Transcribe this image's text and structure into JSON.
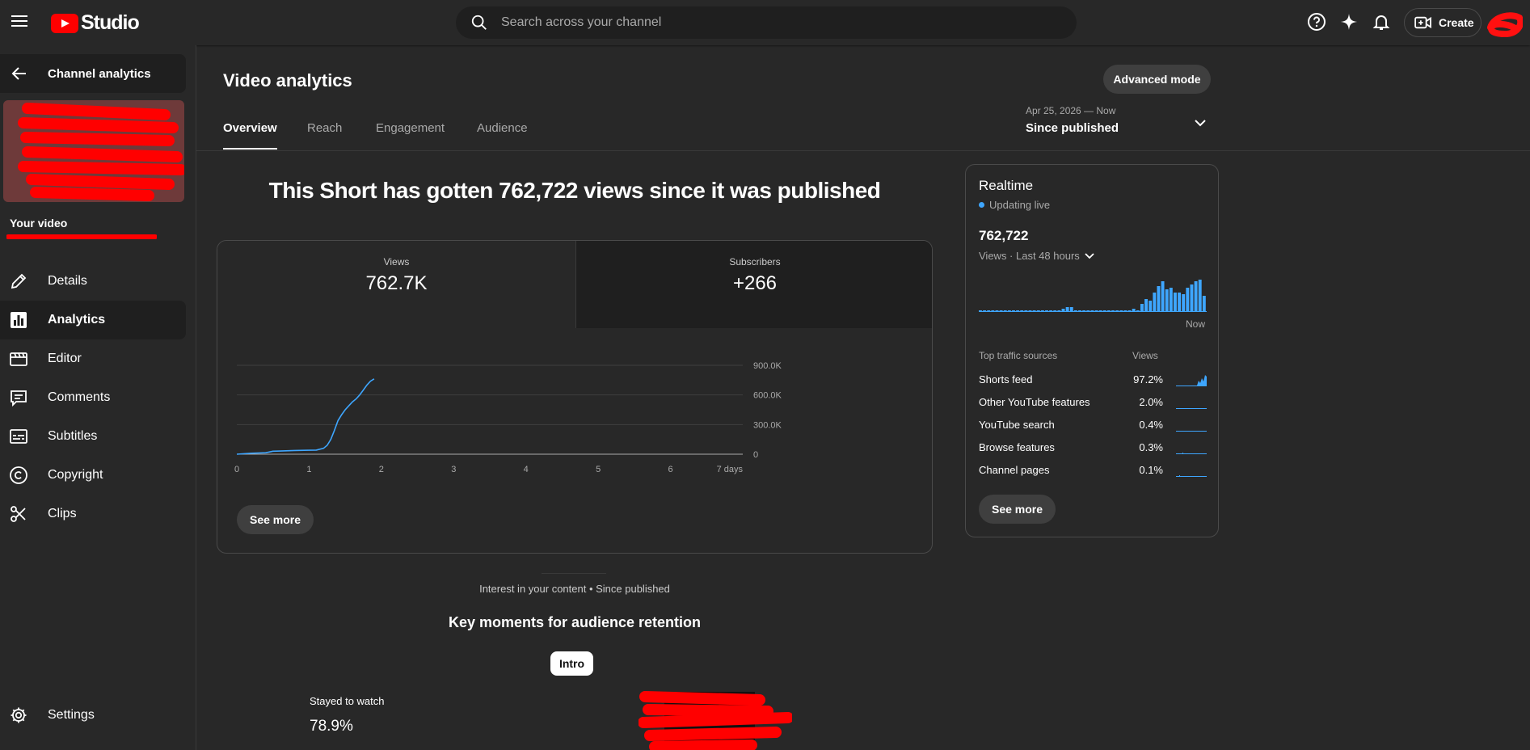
{
  "app": {
    "logo_text": "Studio"
  },
  "search": {
    "placeholder": "Search across your channel"
  },
  "topbar": {
    "create_label": "Create"
  },
  "sidebar": {
    "back_label": "Channel analytics",
    "your_video_label": "Your video",
    "items": [
      {
        "label": "Details",
        "icon": "pencil-icon"
      },
      {
        "label": "Analytics",
        "icon": "analytics-icon"
      },
      {
        "label": "Editor",
        "icon": "clapperboard-icon"
      },
      {
        "label": "Comments",
        "icon": "comment-icon"
      },
      {
        "label": "Subtitles",
        "icon": "subtitles-icon"
      },
      {
        "label": "Copyright",
        "icon": "copyright-icon"
      },
      {
        "label": "Clips",
        "icon": "scissors-icon"
      }
    ],
    "settings_label": "Settings"
  },
  "main": {
    "title": "Video analytics",
    "advanced_label": "Advanced mode",
    "tabs": [
      "Overview",
      "Reach",
      "Engagement",
      "Audience"
    ],
    "active_tab": "Overview",
    "date_range": "Apr 25, 2026 — Now",
    "date_label": "Since published",
    "headline": "This Short has gotten 762,722 views since it was published",
    "metrics": [
      {
        "label": "Views",
        "value": "762.7K"
      },
      {
        "label": "Subscribers",
        "value": "+266"
      }
    ],
    "see_more_label": "See more",
    "interest_label": "Interest in your content • Since published",
    "key_moments_title": "Key moments for audience retention",
    "intro_chip": "Intro",
    "stayed_label": "Stayed to watch",
    "stayed_value": "78.9%"
  },
  "chart_data": {
    "type": "line",
    "x_ticks": [
      "0",
      "1",
      "2",
      "3",
      "4",
      "5",
      "6",
      "7 days"
    ],
    "y_ticks": [
      "900.0K",
      "600.0K",
      "300.0K",
      "0"
    ],
    "ylim": [
      0,
      900000
    ],
    "xlim": [
      0,
      7
    ],
    "grid": true,
    "line_color": "#3ea6ff",
    "series": [
      {
        "x": [
          0,
          0.2,
          0.4,
          0.5,
          0.6,
          0.8,
          1.0,
          1.1,
          1.2,
          1.25,
          1.3,
          1.35,
          1.4,
          1.45,
          1.5,
          1.55,
          1.6,
          1.65,
          1.7,
          1.75,
          1.8,
          1.85,
          1.9
        ],
        "y": [
          0,
          10000,
          15000,
          30000,
          32000,
          38000,
          40000,
          42000,
          60000,
          90000,
          150000,
          240000,
          340000,
          400000,
          450000,
          490000,
          530000,
          560000,
          600000,
          650000,
          700000,
          740000,
          762722
        ]
      }
    ]
  },
  "realtime": {
    "title": "Realtime",
    "live_label": "Updating live",
    "count": "762,722",
    "subtitle": "Views · Last 48 hours",
    "now_label": "Now",
    "bars": [
      1,
      1,
      1,
      1,
      1,
      1,
      1,
      1,
      1,
      1,
      1,
      1,
      1,
      1,
      1,
      1,
      1,
      1,
      1,
      1,
      2,
      3,
      3,
      1,
      1,
      1,
      1,
      1,
      1,
      1,
      1,
      1,
      1,
      1,
      1,
      1,
      1,
      2,
      1,
      5,
      8,
      7,
      12,
      16,
      19,
      14,
      15,
      12,
      12,
      11,
      15,
      17,
      19,
      20,
      10
    ],
    "bars_max": 20,
    "bar_color": "#3ea6ff",
    "traffic_header": "Top traffic sources",
    "views_header": "Views",
    "traffic": [
      {
        "name": "Shorts feed",
        "pct": "97.2%"
      },
      {
        "name": "Other YouTube features",
        "pct": "2.0%"
      },
      {
        "name": "YouTube search",
        "pct": "0.4%"
      },
      {
        "name": "Browse features",
        "pct": "0.3%"
      },
      {
        "name": "Channel pages",
        "pct": "0.1%"
      }
    ],
    "see_more_label": "See more"
  },
  "colors": {
    "accent": "#3ea6ff",
    "brand": "#ff0000",
    "background": "#282828"
  }
}
